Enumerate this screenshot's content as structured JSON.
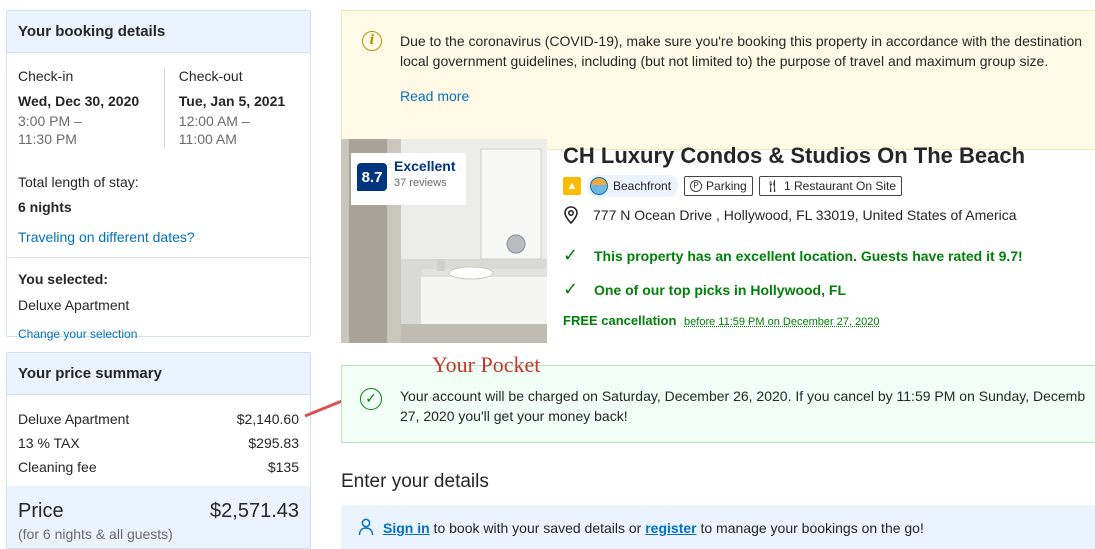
{
  "booking": {
    "title": "Your booking details",
    "checkin": {
      "label": "Check-in",
      "date": "Wed, Dec 30, 2020",
      "time_from": "3:00 PM –",
      "time_to": "11:30 PM"
    },
    "checkout": {
      "label": "Check-out",
      "date": "Tue, Jan 5, 2021",
      "time_from": "12:00 AM –",
      "time_to": "11:00 AM"
    },
    "stay_label": "Total length of stay:",
    "stay_value": "6 nights",
    "different_dates_link": "Traveling on different dates?",
    "selected_label": "You selected:",
    "selected_value": "Deluxe Apartment",
    "change_link": "Change your selection"
  },
  "price": {
    "title": "Your price summary",
    "lines": [
      {
        "label": "Deluxe Apartment",
        "amount": "$2,140.60"
      },
      {
        "label": "13 % TAX",
        "amount": "$295.83"
      },
      {
        "label": "Cleaning fee",
        "amount": "$135"
      }
    ],
    "total_label": "Price",
    "total_amount": "$2,571.43",
    "total_sub": "(for 6 nights & all guests)"
  },
  "covid": {
    "line1": "Due to the coronavirus (COVID-19), make sure you're booking this property in accordance with the destination",
    "line2": "local government guidelines, including (but not limited to) the purpose of travel and maximum group size.",
    "read_more": "Read more",
    "icon": "info-icon"
  },
  "property": {
    "score": "8.7",
    "score_word": "Excellent",
    "reviews": "37 reviews",
    "name": "CH Luxury Condos & Studios On The Beach",
    "facilities": {
      "beachfront": "Beachfront",
      "parking": "Parking",
      "restaurant": "1 Restaurant On Site"
    },
    "address": "777 N Ocean Drive , Hollywood, FL 33019, United States of America",
    "highlight1": "This property has an excellent location. Guests have rated it 9.7!",
    "highlight2": "One of our top picks in Hollywood, FL",
    "free_cancel": "FREE cancellation",
    "free_cancel_until": "before 11:59 PM on December 27, 2020"
  },
  "annotation": {
    "text": "Your Pocket",
    "color": "#c0392b"
  },
  "charge": {
    "line1": "Your account will be charged on Saturday, December 26, 2020. If you cancel by 11:59 PM on Sunday, Decemb",
    "line2": "27, 2020 you'll get your money back!"
  },
  "details": {
    "heading": "Enter your details",
    "signin": "Sign in",
    "mid": " to book with your saved details or ",
    "register": "register",
    "tail": " to manage your bookings on the go!"
  },
  "colors": {
    "accent": "#0071c2",
    "brand_dark": "#003580",
    "success": "#008009"
  }
}
